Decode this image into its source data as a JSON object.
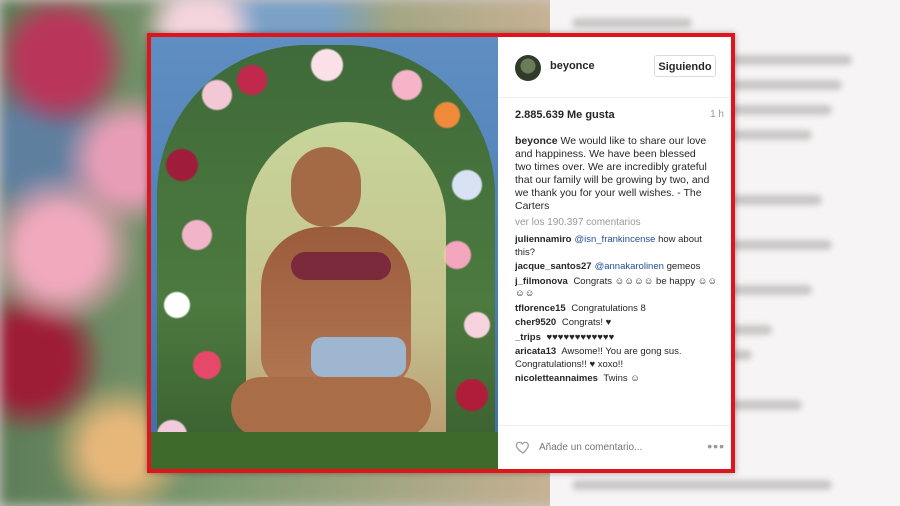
{
  "post": {
    "username": "beyonce",
    "follow_label": "Siguiendo",
    "likes": "2.885.639 Me gusta",
    "time": "1 h",
    "caption_author": "beyonce",
    "caption_text": "We would like to share our love and happiness. We have been blessed two times over. We are incredibly grateful that our family will be growing by two, and we thank you for your well wishes. - The Carters",
    "view_comments": "ver los 190.397 comentarios"
  },
  "comments": [
    {
      "author": "juliennamiro",
      "mention": "@isn_frankincense",
      "text": "how about this?"
    },
    {
      "author": "jacque_santos27",
      "mention": "@annakarolinen",
      "text": "gemeos"
    },
    {
      "author": "j_filmonova",
      "mention": "",
      "text": "Congrats ☺☺☺☺ be happy ☺☺☺☺"
    },
    {
      "author": "tflorence15",
      "mention": "",
      "text": "Congratulations 8"
    },
    {
      "author": "cher9520",
      "mention": "",
      "text": "Congrats! ♥"
    },
    {
      "author": "_trips",
      "mention": "",
      "text": "♥♥♥♥♥♥♥♥♥♥♥♥"
    },
    {
      "author": "aricata13",
      "mention": "",
      "text": "Awsome!! You are gong sus. Congratulations!! ♥ xoxo!!"
    },
    {
      "author": "nicoletteannaimes",
      "mention": "",
      "text": "Twins ☺"
    }
  ],
  "footer": {
    "add_comment_placeholder": "Añade un comentario...",
    "more": "•••"
  },
  "icons": {
    "heart": "heart-icon",
    "more": "more-options-icon"
  },
  "colors": {
    "frame_border": "#e0141b",
    "mention": "#1d4f91"
  }
}
